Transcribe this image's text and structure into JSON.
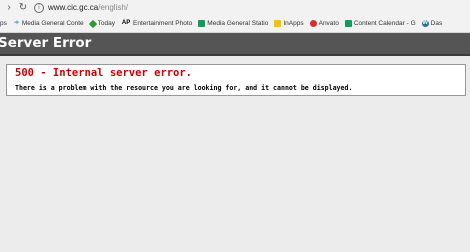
{
  "browser": {
    "url_host": "www.cic.gc.ca",
    "url_path": "/english/",
    "bookmarks": [
      {
        "label": "ps",
        "icon": "apps-icon",
        "color": "#4285f4"
      },
      {
        "label": "Media General Conte",
        "icon": "arrow-icon",
        "color": "#4aa0d8"
      },
      {
        "label": "Today",
        "icon": "today-icon",
        "color": "#2e9b3a"
      },
      {
        "label": "Entertainment Photo",
        "icon": "ap-icon",
        "color": "#cc0000"
      },
      {
        "label": "Media General Statio",
        "icon": "sheets-icon",
        "color": "#0f9d58"
      },
      {
        "label": "InApps",
        "icon": "folder-icon",
        "color": "#f4c20d"
      },
      {
        "label": "Anvato",
        "icon": "anvato-icon",
        "color": "#d32f2f"
      },
      {
        "label": "Content Calendar - G",
        "icon": "sheets-icon",
        "color": "#0f9d58"
      },
      {
        "label": "Das",
        "icon": "wordpress-icon",
        "color": "#21759b"
      }
    ]
  },
  "page": {
    "header_title": "Server Error",
    "error_code": "500 - Internal server error.",
    "error_message": "There is a problem with the resource you are looking for, and it cannot be displayed."
  }
}
